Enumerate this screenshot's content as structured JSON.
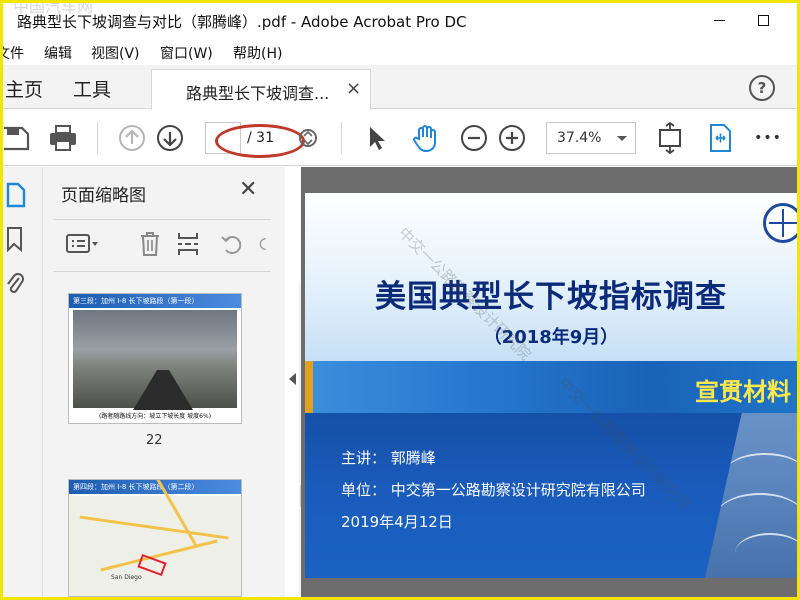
{
  "window": {
    "title": "路典型长下坡调查与对比（郭腾峰）.pdf - Adobe Acrobat Pro DC",
    "watermark": "中国汽车网"
  },
  "menu": {
    "items": [
      "文件",
      "编辑",
      "视图(V)",
      "窗口(W)",
      "帮助(H)"
    ]
  },
  "tabs": {
    "home": "主页",
    "tools": "工具",
    "document": "路典型长下坡调查...",
    "close_symbol": "×",
    "help_symbol": "?"
  },
  "toolbar": {
    "current_page": "",
    "page_total": "/ 31",
    "zoom": "37.4%",
    "more_symbol": "•••"
  },
  "panel": {
    "title": "页面缩略图",
    "close_symbol": "✕",
    "thumbnails": [
      {
        "header": "第三段：加州 I-8 长下坡路段（第一段）",
        "caption": "(路者随路线方向：坡立下坡长度 坡度6%)",
        "page_number": "22"
      },
      {
        "header": "第四段：加州 I-8 长下坡路段（第二段）",
        "map_label": "San Diego"
      }
    ]
  },
  "slide": {
    "title": "美国典型长下坡指标调查",
    "date": "（2018年9月）",
    "band_text": "宣贯材料",
    "presenter": "主讲：  郭腾峰",
    "organization": "单位：  中交第一公路勘察设计研究院有限公司",
    "talk_date": "2019年4月12日",
    "watermark": "中交一公路勘察设计研究院"
  },
  "colors": {
    "accent_blue": "#1a63b8",
    "title_navy": "#0b2a7a",
    "band_yellow": "#ffe94a",
    "hand_tool_blue": "#1f87d6",
    "annotation_red": "#c0392b"
  }
}
